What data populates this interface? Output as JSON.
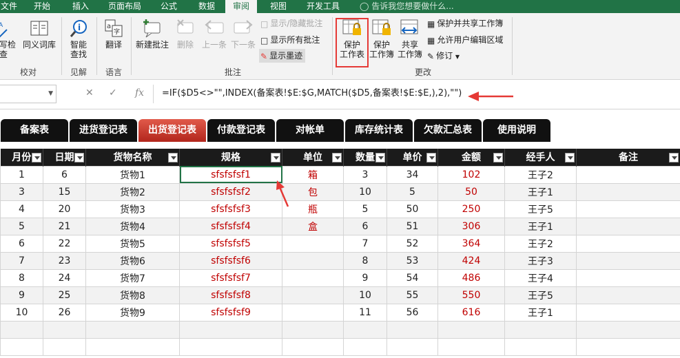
{
  "ribbon_tabs": [
    "文件",
    "开始",
    "插入",
    "页面布局",
    "公式",
    "数据",
    "审阅",
    "视图",
    "开发工具"
  ],
  "active_tab": "审阅",
  "tell_me": "告诉我您想要做什么...",
  "groups": {
    "proofing": {
      "label": "校对",
      "buttons": [
        "拼写检查",
        "同义词库"
      ]
    },
    "insights": {
      "label": "见解",
      "buttons": [
        "智能",
        "查找"
      ]
    },
    "language": {
      "label": "语言",
      "buttons": [
        "翻译"
      ]
    },
    "comments": {
      "label": "批注",
      "buttons": [
        "新建批注",
        "删除",
        "上一条",
        "下一条"
      ],
      "side": [
        "显示/隐藏批注",
        "显示所有批注",
        "显示墨迹"
      ]
    },
    "changes": {
      "label": "更改",
      "buttons": [
        {
          "l1": "保护",
          "l2": "工作表"
        },
        {
          "l1": "保护",
          "l2": "工作簿"
        },
        {
          "l1": "共享",
          "l2": "工作簿"
        }
      ],
      "side": [
        "保护并共享工作簿",
        "允许用户编辑区域",
        "修订"
      ]
    }
  },
  "namebox": "",
  "formula": "=IF($D5<>\"\",INDEX(备案表!$E:$G,MATCH($D5,备案表!$E:$E,),2),\"\")",
  "sheet_nav": [
    "备案表",
    "进货登记表",
    "出货登记表",
    "付款登记表",
    "对帐单",
    "库存统计表",
    "欠款汇总表",
    "使用说明"
  ],
  "active_sheet": "出货登记表",
  "columns": [
    "月份",
    "日期",
    "货物名称",
    "规格",
    "单位",
    "数量",
    "单价",
    "金额",
    "经手人",
    "备注"
  ],
  "rows": [
    [
      "1",
      "6",
      "货物1",
      "sfsfsfsf1",
      "箱",
      "3",
      "34",
      "102",
      "王子2",
      ""
    ],
    [
      "3",
      "15",
      "货物2",
      "sfsfsfsf2",
      "包",
      "10",
      "5",
      "50",
      "王子1",
      ""
    ],
    [
      "4",
      "20",
      "货物3",
      "sfsfsfsf3",
      "瓶",
      "5",
      "50",
      "250",
      "王子5",
      ""
    ],
    [
      "5",
      "21",
      "货物4",
      "sfsfsfsf4",
      "盒",
      "6",
      "51",
      "306",
      "王子1",
      ""
    ],
    [
      "6",
      "22",
      "货物5",
      "sfsfsfsf5",
      "",
      "7",
      "52",
      "364",
      "王子2",
      ""
    ],
    [
      "7",
      "23",
      "货物6",
      "sfsfsfsf6",
      "",
      "8",
      "53",
      "424",
      "王子3",
      ""
    ],
    [
      "8",
      "24",
      "货物7",
      "sfsfsfsf7",
      "",
      "9",
      "54",
      "486",
      "王子4",
      ""
    ],
    [
      "9",
      "25",
      "货物8",
      "sfsfsfsf8",
      "",
      "10",
      "55",
      "550",
      "王子5",
      ""
    ],
    [
      "10",
      "26",
      "货物9",
      "sfsfsfsf9",
      "",
      "11",
      "56",
      "616",
      "王子1",
      ""
    ],
    [
      "",
      "",
      "",
      "",
      "",
      "",
      "",
      "",
      "",
      ""
    ],
    [
      "",
      "",
      "",
      "",
      "",
      "",
      "",
      "",
      "",
      ""
    ]
  ],
  "colors": {
    "ribbon_green": "#217346",
    "header_black": "#1b1b1b",
    "active_sheet_red": "#c0392b",
    "value_red": "#c00000",
    "callout_red": "#e53935"
  }
}
